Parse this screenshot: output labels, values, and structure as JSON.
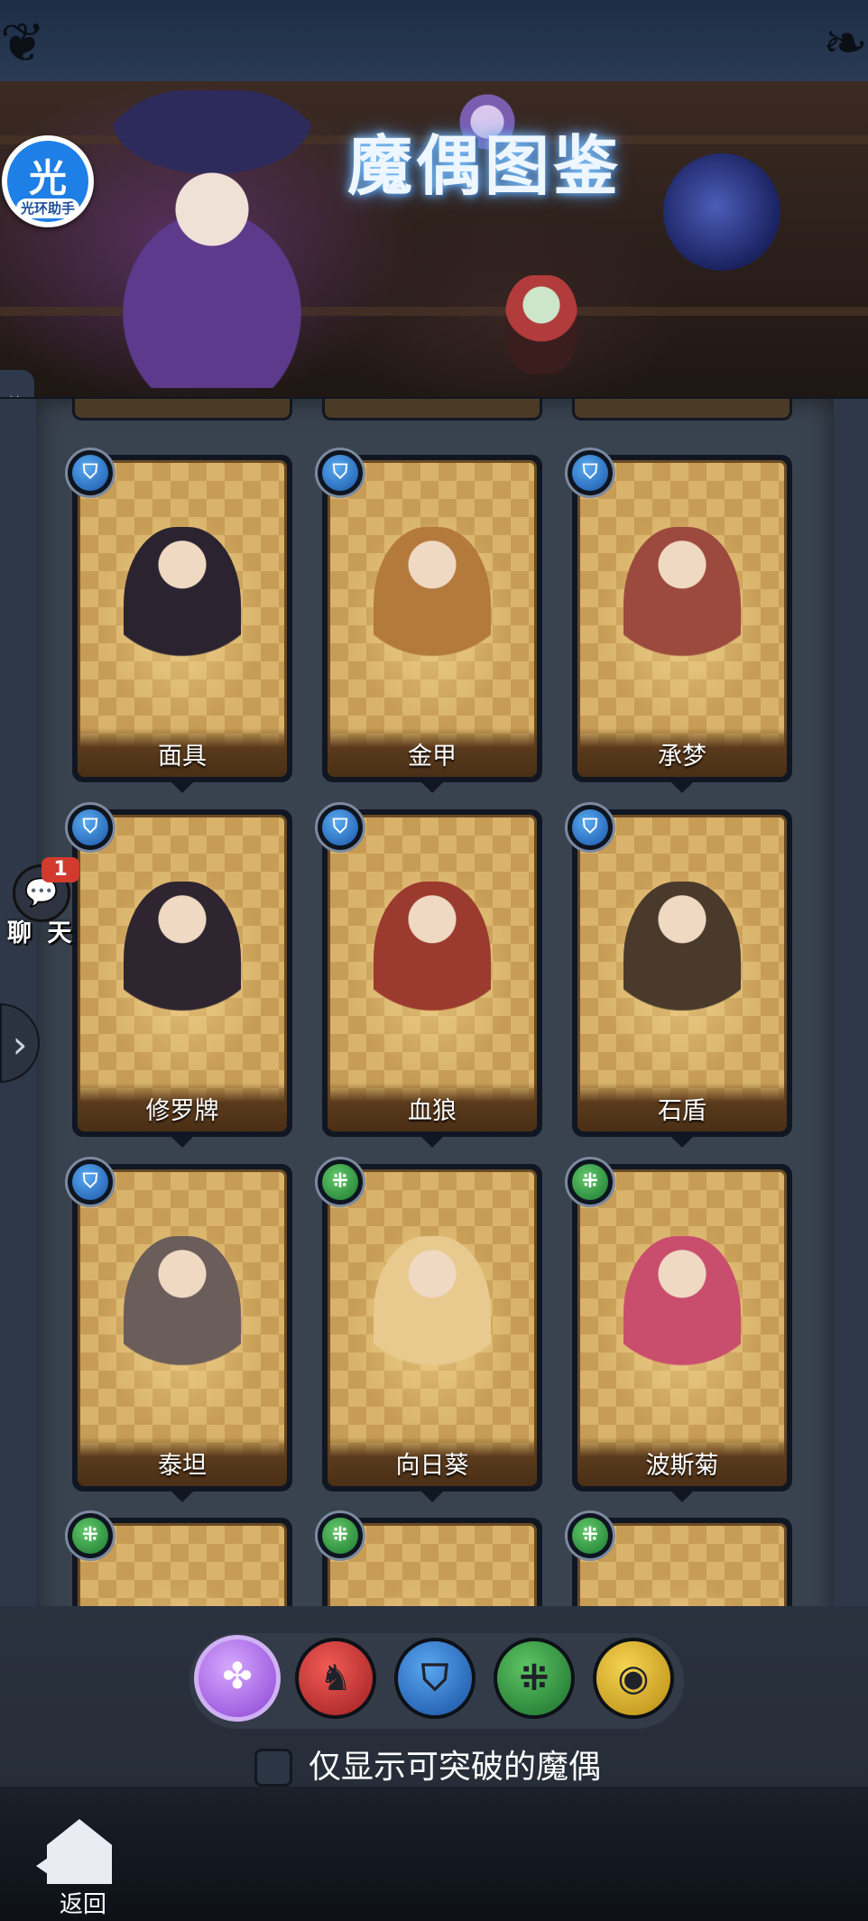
{
  "header": {
    "title": "魔偶图鉴",
    "helper_badge": {
      "char": "光",
      "label": "光环助手"
    }
  },
  "cards": [
    {
      "name": "面具",
      "element": "water",
      "figure_color": "#2b2430"
    },
    {
      "name": "金甲",
      "element": "water",
      "figure_color": "#b47a3c"
    },
    {
      "name": "承梦",
      "element": "water",
      "figure_color": "#9c4a3e"
    },
    {
      "name": "修罗牌",
      "element": "water",
      "figure_color": "#2e2530"
    },
    {
      "name": "血狼",
      "element": "water",
      "figure_color": "#9b3a2e"
    },
    {
      "name": "石盾",
      "element": "water",
      "figure_color": "#4a3a2c"
    },
    {
      "name": "泰坦",
      "element": "water",
      "figure_color": "#6a5d5a"
    },
    {
      "name": "向日葵",
      "element": "wood",
      "figure_color": "#e8c98e"
    },
    {
      "name": "波斯菊",
      "element": "wood",
      "figure_color": "#c94e6e"
    }
  ],
  "chat": {
    "label": "聊 天",
    "unread": "1"
  },
  "filters": [
    {
      "id": "all",
      "icon": "clover-icon",
      "glyph": "✤"
    },
    {
      "id": "fire",
      "icon": "fire-element-icon",
      "glyph": "♞"
    },
    {
      "id": "water",
      "icon": "water-element-icon",
      "glyph": "⛉"
    },
    {
      "id": "wood",
      "icon": "wood-element-icon",
      "glyph": "⁜"
    },
    {
      "id": "light",
      "icon": "light-element-icon",
      "glyph": "◉"
    }
  ],
  "filter_toggle": {
    "label": "仅显示可突破的魔偶",
    "checked": false
  },
  "footer": {
    "back_label": "返回"
  },
  "colors": {
    "water": "#1a56a8",
    "wood": "#1c7a2f",
    "fire": "#9d1f22",
    "light": "#b88c12",
    "all": "#8c45d4"
  }
}
